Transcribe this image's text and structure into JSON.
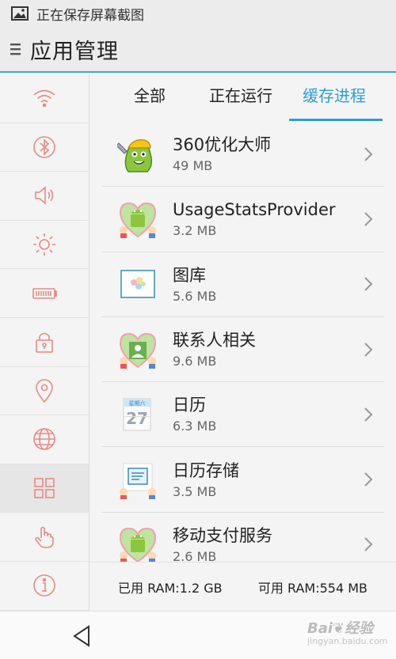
{
  "status_bar": {
    "text": "正在保存屏幕截图"
  },
  "app_bar": {
    "title": "应用管理"
  },
  "tabs": [
    {
      "label": "全部"
    },
    {
      "label": "正在运行"
    },
    {
      "label": "缓存进程"
    }
  ],
  "active_tab": "缓存进程",
  "sidebar": {
    "items": [
      {
        "icon": "wifi-icon"
      },
      {
        "icon": "bluetooth-icon"
      },
      {
        "icon": "volume-icon"
      },
      {
        "icon": "brightness-icon"
      },
      {
        "icon": "battery-icon"
      },
      {
        "icon": "lock-icon"
      },
      {
        "icon": "location-icon"
      },
      {
        "icon": "globe-icon"
      },
      {
        "icon": "apps-grid-icon"
      },
      {
        "icon": "gesture-icon"
      },
      {
        "icon": "info-icon"
      }
    ],
    "active": "apps-grid-icon"
  },
  "apps": [
    {
      "name": "360优化大师",
      "size": "49 MB",
      "icon": "360-optimizer-icon"
    },
    {
      "name": "UsageStatsProvider",
      "size": "3.2 MB",
      "icon": "android-heart-icon"
    },
    {
      "name": "图库",
      "size": "5.6 MB",
      "icon": "gallery-icon"
    },
    {
      "name": "联系人相关",
      "size": "9.6 MB",
      "icon": "contacts-heart-icon"
    },
    {
      "name": "日历",
      "size": "6.3 MB",
      "icon": "calendar-icon"
    },
    {
      "name": "日历存储",
      "size": "3.5 MB",
      "icon": "calendar-storage-icon"
    },
    {
      "name": "移动支付服务",
      "size": "2.6 MB",
      "icon": "android-heart-icon"
    }
  ],
  "ram": {
    "used": "已用 RAM:1.2 GB",
    "free": "可用 RAM:554 MB"
  },
  "calendar_icon": {
    "weekday": "星期六",
    "day": "27"
  },
  "watermark": {
    "brand": "Bai",
    "brand2": "经验",
    "sub": "jingyan.baidu.com"
  },
  "colors": {
    "accent": "#2a9fd6",
    "sidebar_icon": "#e88a84",
    "android_green": "#8cc63f"
  }
}
